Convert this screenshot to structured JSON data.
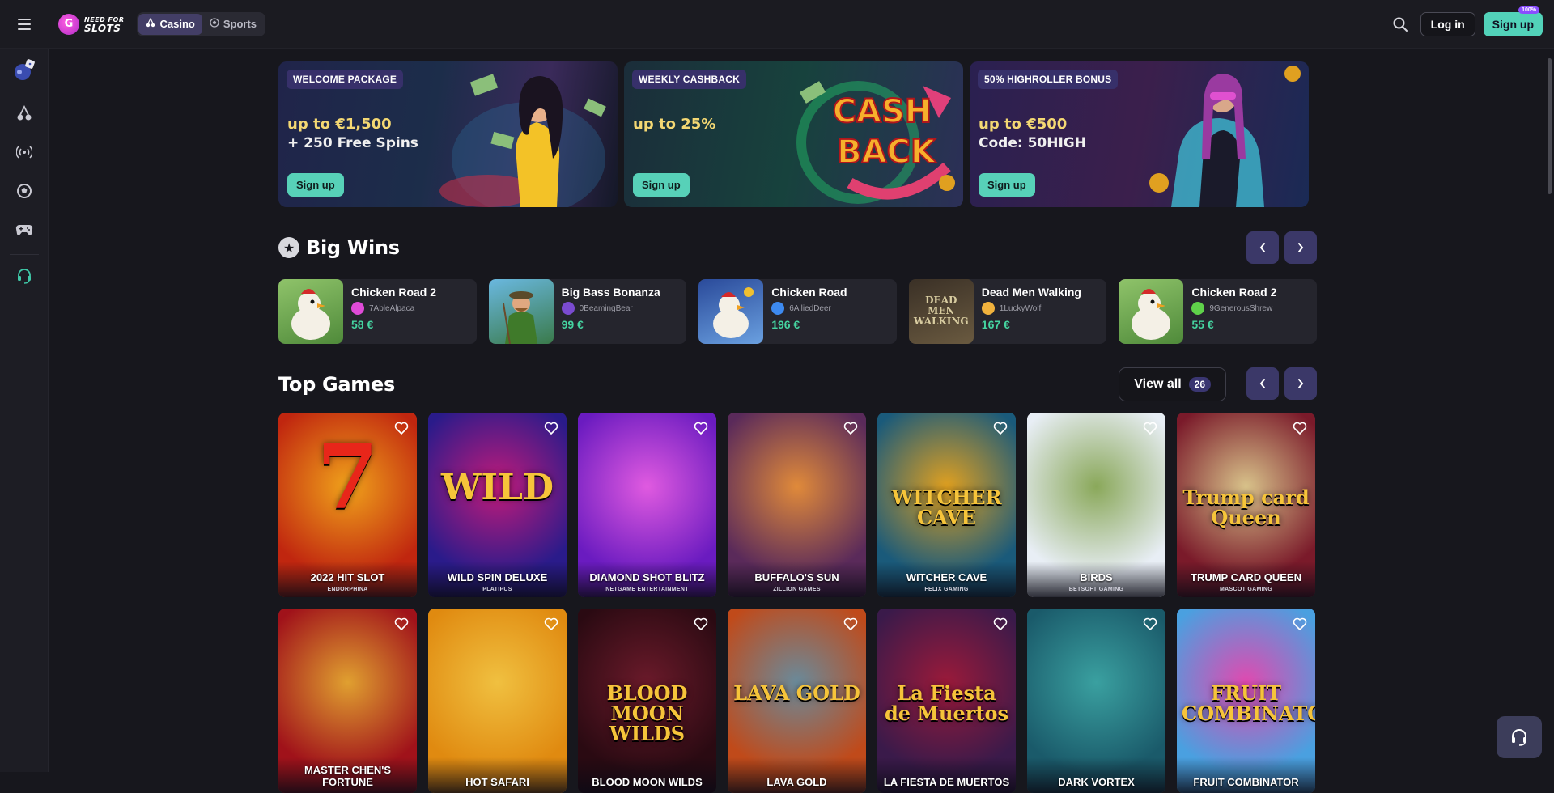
{
  "header": {
    "logo_line1": "NEED FOR",
    "logo_line2": "SLOTS",
    "tabs": [
      {
        "label": "Casino",
        "active": true,
        "icon": "cherries-icon"
      },
      {
        "label": "Sports",
        "active": false,
        "icon": "soccer-ball-icon"
      }
    ],
    "login_label": "Log in",
    "signup_label": "Sign up",
    "signup_badge": "100%"
  },
  "sidebar": {
    "items": [
      {
        "icon": "promo-dice-icon"
      },
      {
        "icon": "cherries-icon"
      },
      {
        "icon": "live-broadcast-icon"
      },
      {
        "icon": "soccer-ball-icon"
      },
      {
        "icon": "gamepad-icon"
      },
      {
        "icon": "headset-icon"
      }
    ]
  },
  "promos": [
    {
      "tag": "WELCOME PACKAGE",
      "title": "up to €1,500",
      "subtitle": "+ 250 Free Spins",
      "button": "Sign up"
    },
    {
      "tag": "WEEKLY CASHBACK",
      "title": "up to 25%",
      "subtitle": "",
      "button": "Sign up",
      "art_text_1": "CASH",
      "art_text_2": "BACK"
    },
    {
      "tag": "50% HIGHROLLER BONUS",
      "title": "up to €500",
      "subtitle": "Code: 50HIGH",
      "button": "Sign up"
    }
  ],
  "big_wins": {
    "title": "Big Wins",
    "items": [
      {
        "game": "Chicken Road 2",
        "user": "7AbleAlpaca",
        "amount": "58 €",
        "avatar_color": "#e04bd8"
      },
      {
        "game": "Big Bass Bonanza",
        "user": "0BeamingBear",
        "amount": "99 €",
        "avatar_color": "#7a4bd0"
      },
      {
        "game": "Chicken Road",
        "user": "6AlliedDeer",
        "amount": "196 €",
        "avatar_color": "#3d8af0"
      },
      {
        "game": "Dead Men Walking",
        "user": "1LuckyWolf",
        "amount": "167 €",
        "avatar_color": "#f0b23d"
      },
      {
        "game": "Chicken Road 2",
        "user": "9GenerousShrew",
        "amount": "55 €",
        "avatar_color": "#5fd24a"
      }
    ],
    "thumb_text_4": "DEAD MEN WALKING"
  },
  "top_games": {
    "title": "Top Games",
    "view_all_label": "View all",
    "view_all_count": "26",
    "row1": [
      {
        "title": "2022 HIT SLOT",
        "provider": "ENDORPHINA",
        "logo": "7",
        "bg": "#c0260f",
        "bg2": "#f0a21b"
      },
      {
        "title": "WILD SPIN DELUXE",
        "provider": "PLATIPUS",
        "logo": "WILD",
        "bg": "#2a1b8a",
        "bg2": "#c21b7a"
      },
      {
        "title": "DIAMOND SHOT BLITZ",
        "provider": "NETGAME ENTERTAINMENT",
        "logo": "",
        "bg": "#6a1bc0",
        "bg2": "#e05ae0"
      },
      {
        "title": "BUFFALO'S SUN",
        "provider": "ZILLION GAMES",
        "logo": "",
        "bg": "#5a2a5a",
        "bg2": "#e08a3a"
      },
      {
        "title": "WITCHER CAVE",
        "provider": "FELIX GAMING",
        "logo": "WITCHER CAVE",
        "bg": "#1a5a7a",
        "bg2": "#e0a020"
      },
      {
        "title": "BIRDS",
        "provider": "BETSOFT GAMING",
        "logo": "",
        "bg": "#e8eef5",
        "bg2": "#8aa85a"
      },
      {
        "title": "TRUMP CARD QUEEN",
        "provider": "MASCOT GAMING",
        "logo": "Trump card Queen",
        "bg": "#7a1a2a",
        "bg2": "#d8c28a"
      }
    ],
    "row2": [
      {
        "title": "MASTER CHEN'S FORTUNE",
        "provider": "",
        "logo": "",
        "bg": "#a0121a",
        "bg2": "#e0a030"
      },
      {
        "title": "HOT SAFARI",
        "provider": "",
        "logo": "",
        "bg": "#e08a10",
        "bg2": "#f0c040"
      },
      {
        "title": "BLOOD MOON WILDS",
        "provider": "",
        "logo": "BLOOD MOON WILDS",
        "bg": "#2a0a12",
        "bg2": "#6a1a2a"
      },
      {
        "title": "LAVA GOLD",
        "provider": "",
        "logo": "LAVA GOLD",
        "bg": "#c04a1a",
        "bg2": "#6a8a9a"
      },
      {
        "title": "LA FIESTA DE MUERTOS",
        "provider": "",
        "logo": "La Fiesta de Muertos",
        "bg": "#3a1a4a",
        "bg2": "#9a1a3a"
      },
      {
        "title": "DARK VORTEX",
        "provider": "",
        "logo": "",
        "bg": "#1a5a6a",
        "bg2": "#3aa0a0"
      },
      {
        "title": "FRUIT COMBINATOR",
        "provider": "",
        "logo": "FRUIT COMBINATOR",
        "bg": "#4aa0e0",
        "bg2": "#e04ab0"
      }
    ]
  }
}
